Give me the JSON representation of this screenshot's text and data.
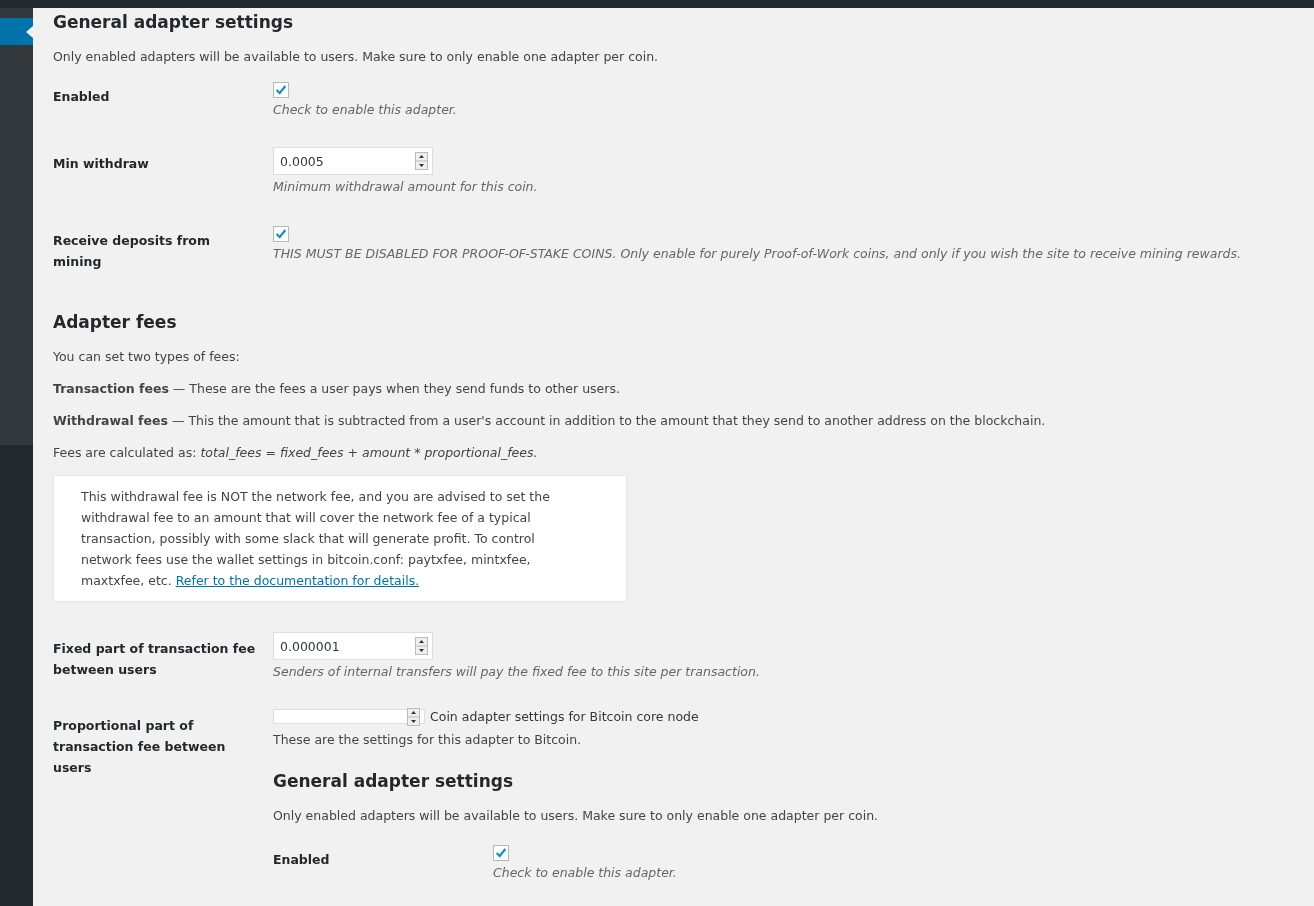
{
  "blocks": [
    {
      "kind": "heading",
      "text": "General adapter settings"
    },
    {
      "kind": "paragraph",
      "text": "Only enabled adapters will be available to users. Make sure to only enable one adapter per coin."
    },
    {
      "kind": "field",
      "label": "Enabled",
      "control": {
        "kind": "checkbox",
        "checked": true
      },
      "description": "Check to enable this adapter."
    },
    {
      "kind": "field",
      "label": "Min withdraw",
      "control": {
        "kind": "number",
        "value": "0.0005"
      },
      "description": "Minimum withdrawal amount for this coin."
    },
    {
      "kind": "field",
      "label": "Receive deposits from mining",
      "control": {
        "kind": "checkbox",
        "checked": true
      },
      "description": "THIS MUST BE DISABLED FOR PROOF-OF-STAKE COINS. Only enable for purely Proof-of-Work coins, and only if you wish the site to receive mining rewards."
    },
    {
      "kind": "heading",
      "text": "Adapter fees"
    },
    {
      "kind": "paragraph",
      "text": "You can set two types of fees:"
    },
    {
      "kind": "paragraph",
      "text": "**Transaction fees** — These are the fees a user pays when they send funds to other users."
    },
    {
      "kind": "paragraph",
      "text": "**Withdrawal fees** — This the amount that is subtracted from a user's account in addition to the amount that they send to another address on the blockchain."
    },
    {
      "kind": "formula",
      "text": "Fees are calculated as:",
      "formula": "total_fees = fixed_fees + amount * proportional_fees."
    },
    {
      "kind": "note",
      "text": "This withdrawal fee is NOT the network fee, and you are advised to set the withdrawal fee to an amount that will cover the network fee of a typical transaction, possibly with some slack that will generate profit. To control network fees use the wallet settings in bitcoin.conf: paytxfee, mintxfee, maxtxfee, etc.",
      "link": "Refer to the documentation for details."
    },
    {
      "kind": "field",
      "label": "Fixed part of transaction fee between users",
      "control": {
        "kind": "number",
        "value": "0.000001"
      },
      "description": "Senders of internal transfers will pay the fixed fee to this site per transaction."
    },
    {
      "kind": "field",
      "label": "Proportional part of transaction fee between users",
      "control": {
        "kind": "number-broken",
        "after": "Coin adapter settings for Bitcoin core node"
      },
      "blocks": [
        {
          "kind": "paragraph",
          "text": "These are the settings for this adapter to Bitcoin."
        },
        {
          "kind": "heading",
          "text": "General adapter settings"
        },
        {
          "kind": "paragraph",
          "text": "Only enabled adapters will be available to users. Make sure to only enable one adapter per coin."
        },
        {
          "kind": "field",
          "label": "Enabled",
          "control": {
            "kind": "checkbox",
            "checked": true
          },
          "description": "Check to enable this adapter."
        }
      ]
    }
  ]
}
